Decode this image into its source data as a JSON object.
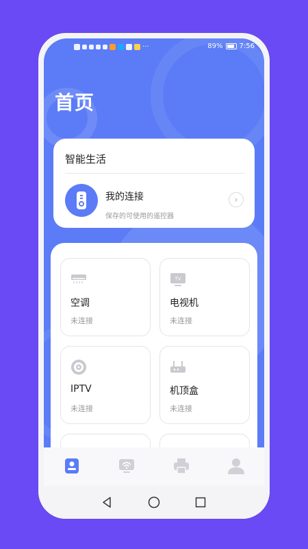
{
  "status_bar": {
    "battery": "89%",
    "time": "7:56"
  },
  "page": {
    "title": "首页"
  },
  "smart_life": {
    "heading": "智能生活",
    "connection_title": "我的连接",
    "connection_subtitle": "保存的可使用的遥控器"
  },
  "devices": [
    {
      "name": "空调",
      "status": "未连接",
      "icon": "air-conditioner-icon"
    },
    {
      "name": "电视机",
      "status": "未连接",
      "icon": "tv-icon"
    },
    {
      "name": "IPTV",
      "status": "未连接",
      "icon": "disc-icon"
    },
    {
      "name": "机顶盒",
      "status": "未连接",
      "icon": "router-icon"
    },
    {
      "name": "",
      "status": "",
      "icon": "router-icon"
    },
    {
      "name": "",
      "status": "",
      "icon": "camera-icon"
    }
  ],
  "tabs": [
    {
      "icon": "home-remote-icon",
      "active": true
    },
    {
      "icon": "wifi-tv-icon",
      "active": false
    },
    {
      "icon": "printer-icon",
      "active": false
    },
    {
      "icon": "profile-icon",
      "active": false
    }
  ],
  "colors": {
    "background": "#6a4af5",
    "accent": "#5b7cf6",
    "inactive_icon": "#d0d0d6"
  }
}
